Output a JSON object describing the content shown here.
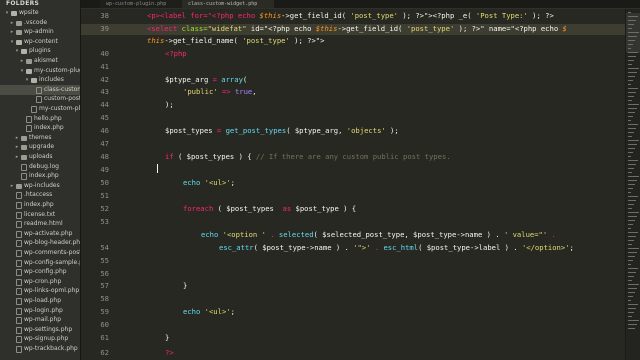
{
  "tabs": {
    "inactive_label": "wp-custom-plugin.php",
    "active_label": "class-custom-widget.php"
  },
  "sidebar": {
    "title": "FOLDERS",
    "items": [
      {
        "label": "wpsite",
        "kind": "folder",
        "open": true,
        "depth": 0
      },
      {
        "label": ".vscode",
        "kind": "folder",
        "open": false,
        "depth": 1
      },
      {
        "label": "wp-admin",
        "kind": "folder",
        "open": false,
        "depth": 1
      },
      {
        "label": "wp-content",
        "kind": "folder",
        "open": true,
        "depth": 1
      },
      {
        "label": "plugins",
        "kind": "folder",
        "open": true,
        "depth": 2
      },
      {
        "label": "akismet",
        "kind": "folder",
        "open": false,
        "depth": 3
      },
      {
        "label": "my-custom-plugin",
        "kind": "folder",
        "open": true,
        "depth": 3
      },
      {
        "label": "includes",
        "kind": "folder",
        "open": true,
        "depth": 4
      },
      {
        "label": "class-custom-widget.php",
        "kind": "file",
        "depth": 5,
        "selected": true
      },
      {
        "label": "custom-post-types.php",
        "kind": "file",
        "depth": 5
      },
      {
        "label": "my-custom-plugin.php",
        "kind": "file",
        "depth": 4
      },
      {
        "label": "hello.php",
        "kind": "file",
        "depth": 3
      },
      {
        "label": "index.php",
        "kind": "file",
        "depth": 3
      },
      {
        "label": "themes",
        "kind": "folder",
        "open": false,
        "depth": 2
      },
      {
        "label": "upgrade",
        "kind": "folder",
        "open": false,
        "depth": 2
      },
      {
        "label": "uploads",
        "kind": "folder",
        "open": false,
        "depth": 2
      },
      {
        "label": "debug.log",
        "kind": "file",
        "depth": 2
      },
      {
        "label": "index.php",
        "kind": "file",
        "depth": 2
      },
      {
        "label": "wp-includes",
        "kind": "folder",
        "open": false,
        "depth": 1
      },
      {
        "label": ".htaccess",
        "kind": "file",
        "depth": 1
      },
      {
        "label": "index.php",
        "kind": "file",
        "depth": 1
      },
      {
        "label": "license.txt",
        "kind": "file",
        "depth": 1
      },
      {
        "label": "readme.html",
        "kind": "file",
        "depth": 1
      },
      {
        "label": "wp-activate.php",
        "kind": "file",
        "depth": 1
      },
      {
        "label": "wp-blog-header.php",
        "kind": "file",
        "depth": 1
      },
      {
        "label": "wp-comments-post.php",
        "kind": "file",
        "depth": 1
      },
      {
        "label": "wp-config-sample.php",
        "kind": "file",
        "depth": 1
      },
      {
        "label": "wp-config.php",
        "kind": "file",
        "depth": 1
      },
      {
        "label": "wp-cron.php",
        "kind": "file",
        "depth": 1
      },
      {
        "label": "wp-links-opml.php",
        "kind": "file",
        "depth": 1
      },
      {
        "label": "wp-load.php",
        "kind": "file",
        "depth": 1
      },
      {
        "label": "wp-login.php",
        "kind": "file",
        "depth": 1
      },
      {
        "label": "wp-mail.php",
        "kind": "file",
        "depth": 1
      },
      {
        "label": "wp-settings.php",
        "kind": "file",
        "depth": 1
      },
      {
        "label": "wp-signup.php",
        "kind": "file",
        "depth": 1
      },
      {
        "label": "wp-trackback.php",
        "kind": "file",
        "depth": 1
      }
    ]
  },
  "gutter": [
    "38",
    "39",
    "",
    "40",
    "41",
    "42",
    "43",
    "44",
    "45",
    "46",
    "47",
    "48",
    "49",
    "50",
    "51",
    "52",
    "53",
    "",
    "54",
    "55",
    "56",
    "57",
    "58",
    "59",
    "60",
    "61",
    "62"
  ],
  "code": {
    "l38": [
      "<p><label for=\"<?php echo ",
      "$this",
      "->get_field_id( ",
      "'post_type'",
      " ); ?>\"><?php _e( ",
      "'Post Type:'",
      " ); ?>"
    ],
    "l39a": [
      "<select",
      " class=",
      "\"widefat\"",
      " id=\"<?php echo ",
      "$this",
      "->get_field_id( ",
      "'post_type'",
      " ); ?>\" name=\"<?php echo ",
      "$"
    ],
    "l39b": [
      "this",
      "->get_field_name( ",
      "'post_type'",
      " ); ?>\">"
    ],
    "l40": "<?php",
    "l42a": "$ptype_arg",
    "l42b": " = ",
    "l42c": "array",
    "l42d": "(",
    "l43a": "'public'",
    "l43b": " => ",
    "l43c": "true",
    "l43d": ",",
    "l44": ");",
    "l46a": "$post_types",
    "l46b": " = ",
    "l46c": "get_post_types",
    "l46d": "( $ptype_arg, ",
    "l46e": "'objects'",
    "l46f": " );",
    "l48a": "if",
    "l48b": " ( $post_types ) { ",
    "l48c": "// If there are any custom public post types.",
    "l50a": "echo",
    "l50b": " ",
    "l50c": "'<ul>'",
    "l50d": ";",
    "l52a": "foreach",
    "l52b": " ( $post_types  ",
    "l52c": "as",
    "l52d": " $post_type ) {",
    "l54a": "echo",
    "l54b": " ",
    "l54c": "'<option '",
    "l54d": " . ",
    "l54e": "selected",
    "l54f": "( $selected_post_type, $post_type->name ) . ",
    "l54g": "' value=\"'",
    "l54h": " .",
    "l54i": "esc_attr",
    "l54j": "( $post_type->name ) . ",
    "l54k": "'\">'",
    "l54l": " . ",
    "l54m": "esc_html",
    "l54n": "( $post_type->label ) . ",
    "l54o": "'</option>'",
    "l54p": ";",
    "l57": "}",
    "l59a": "echo",
    "l59b": " ",
    "l59c": "'<ul>'",
    "l59d": ";",
    "l61": "}",
    "l62": "?>"
  },
  "colors": {
    "background": "#272822",
    "tag": "#f92672",
    "attribute": "#a6e22e",
    "string": "#e6db74",
    "variable": "#fd971f",
    "function": "#66d9ef",
    "comment": "#75715e",
    "constant": "#ae81ff"
  }
}
